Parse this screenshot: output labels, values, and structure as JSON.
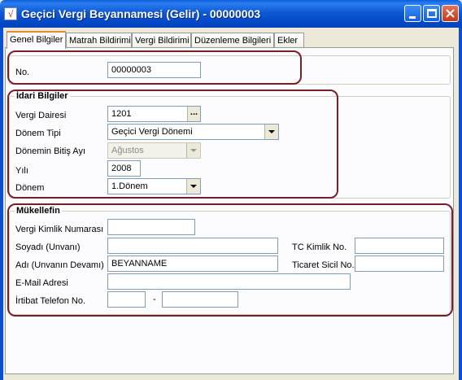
{
  "window": {
    "title": "Geçici Vergi Beyannamesi (Gelir) - 00000003",
    "app_icon_glyph": "√"
  },
  "tabs": [
    {
      "label": "Genel Bilgiler"
    },
    {
      "label": "Matrah Bildirimi"
    },
    {
      "label": "Vergi Bildirimi"
    },
    {
      "label": "Düzenleme Bilgileri"
    },
    {
      "label": "Ekler"
    }
  ],
  "general": {
    "no_label": "No.",
    "no_value": "00000003"
  },
  "idari": {
    "title": "İdari Bilgiler",
    "vergi_dairesi_label": "Vergi Dairesi",
    "vergi_dairesi_value": "1201",
    "browse_glyph": "...",
    "donem_tipi_label": "Dönem Tipi",
    "donem_tipi_value": "Geçici Vergi Dönemi",
    "bitis_ayi_label": "Dönemin Bitiş Ayı",
    "bitis_ayi_value": "Ağustos",
    "yil_label": "Yılı",
    "yil_value": "2008",
    "donem_label": "Dönem",
    "donem_value": "1.Dönem"
  },
  "mukellef": {
    "title": "Mükellefin",
    "vkn_label": "Vergi Kimlik Numarası",
    "vkn_value": "",
    "soyadi_label": "Soyadı (Unvanı)",
    "soyadi_value": "",
    "tckn_label": "TC Kimlik No.",
    "tckn_value": "",
    "adi_label": "Adı (Unvanın Devamı)",
    "adi_value": "BEYANNAME",
    "sicil_label": "Ticaret Sicil No.",
    "sicil_value": "",
    "email_label": "E-Mail Adresi",
    "email_value": "",
    "tel_label": "İrtibat Telefon No.",
    "tel_area": "",
    "tel_sep": "-",
    "tel_number": ""
  },
  "colors": {
    "titlebar": "#0a5fd8",
    "highlight": "#7a1e2a",
    "tab_accent": "#e68b2c"
  }
}
